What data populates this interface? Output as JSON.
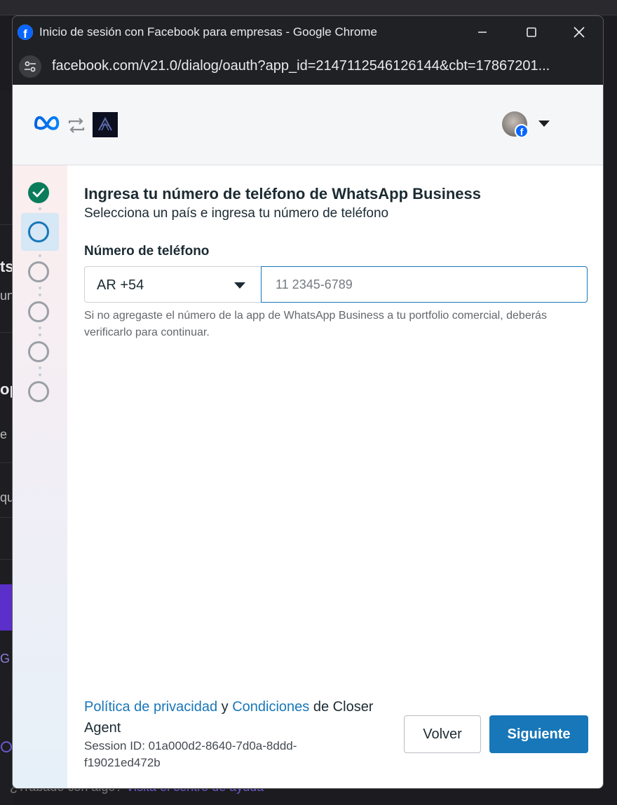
{
  "window": {
    "title": "Inicio de sesión con Facebook para empresas - Google Chrome",
    "url": "facebook.com/v21.0/dialog/oauth?app_id=2147112546126144&cbt=17867201..."
  },
  "background": {
    "frag1": "ts",
    "frag2": "un",
    "frag3": "op",
    "frag4": "e",
    "frag5": "qu",
    "frag6": "G",
    "bottom_text": "¿Trabado con algo?",
    "bottom_link": "Visita el centro de ayuda"
  },
  "header": {
    "account_menu": "account"
  },
  "steps": [
    {
      "state": "done"
    },
    {
      "state": "active"
    },
    {
      "state": "pending"
    },
    {
      "state": "pending"
    },
    {
      "state": "pending"
    },
    {
      "state": "pending"
    }
  ],
  "main": {
    "title": "Ingresa tu número de teléfono de WhatsApp Business",
    "subtitle": "Selecciona un país e ingresa tu número de teléfono",
    "phone_label": "Número de teléfono",
    "country_value": "AR +54",
    "phone_placeholder": "11 2345-6789",
    "phone_value": "",
    "hint": "Si no agregaste el número de la app de WhatsApp Business a tu portfolio comercial, deberás verificarlo para continuar."
  },
  "footer": {
    "privacy_link": "Política de privacidad",
    "and": "y",
    "terms_link": "Condiciones",
    "of_app": "de Closer Agent",
    "session_id": "Session ID: 01a000d2-8640-7d0a-8ddd-f19021ed472b",
    "back_label": "Volver",
    "next_label": "Siguiente"
  },
  "colors": {
    "accent": "#1877b8",
    "done": "#0a7c5c",
    "pending": "#9aa0a6"
  }
}
